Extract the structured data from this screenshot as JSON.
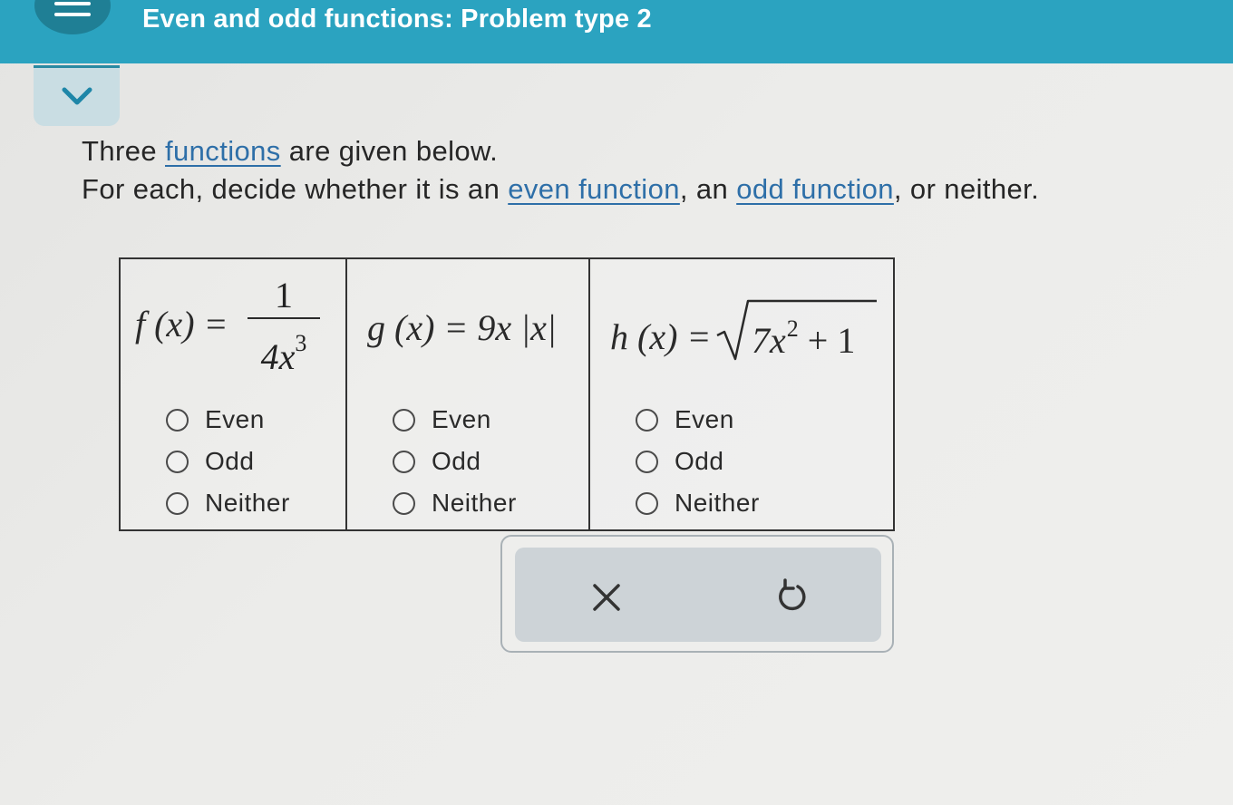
{
  "header": {
    "title": "Even and odd functions: Problem type 2"
  },
  "instructions": {
    "line1_pre": "Three ",
    "line1_link": "functions",
    "line1_post": " are given below.",
    "line2_pre": "For each, decide whether it is an ",
    "line2_link1": "even function",
    "line2_mid": ", an ",
    "line2_link2": "odd function",
    "line2_post": ", or neither."
  },
  "functions": [
    {
      "lhs": "f (x) =",
      "numerator": "1",
      "denominator_base": "4x",
      "denominator_exp": "3",
      "options": [
        "Even",
        "Odd",
        "Neither"
      ]
    },
    {
      "lhs": "g (x) = 9x |x|",
      "options": [
        "Even",
        "Odd",
        "Neither"
      ]
    },
    {
      "lhs": "h (x) =",
      "radicand_coef": "7x",
      "radicand_exp": "2",
      "radicand_rest": " + 1",
      "options": [
        "Even",
        "Odd",
        "Neither"
      ]
    }
  ],
  "actions": {
    "clear_icon": "close-icon",
    "undo_icon": "undo-icon"
  },
  "colors": {
    "header": "#2ba3c0",
    "link": "#2e6fa8",
    "action_panel": "#cdd3d7"
  }
}
